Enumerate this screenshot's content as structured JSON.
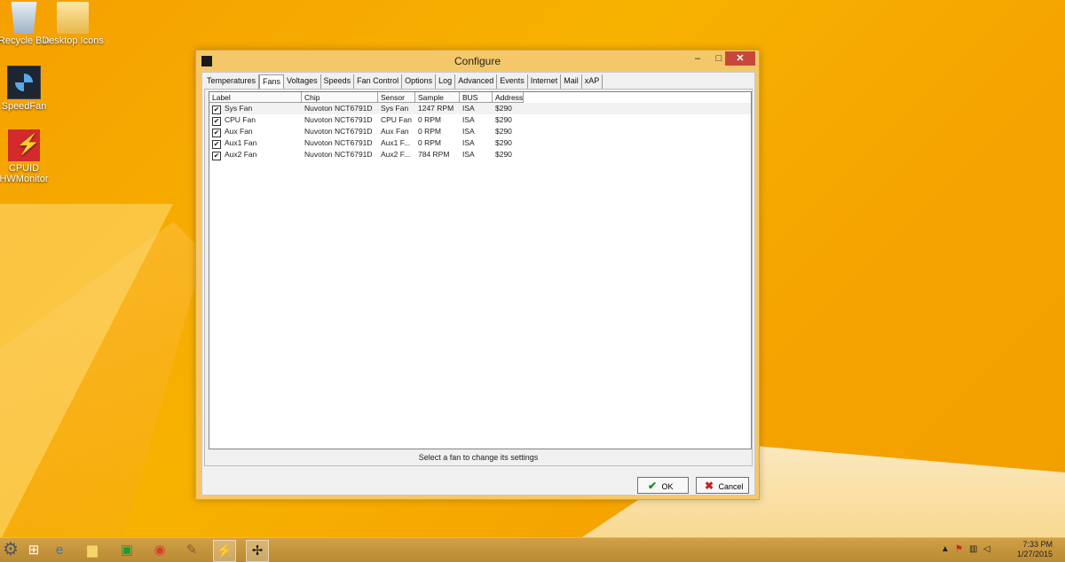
{
  "desktop": {
    "icons": [
      {
        "label": "Recycle Bin"
      },
      {
        "label": "Desktop Icons"
      },
      {
        "label": "SpeedFan"
      },
      {
        "label": "CPUID HWMonitor"
      }
    ]
  },
  "window": {
    "title": "Configure",
    "controls": {
      "minimize": "–",
      "maximize": "□",
      "close": "✕"
    },
    "tabs": [
      "Temperatures",
      "Fans",
      "Voltages",
      "Speeds",
      "Fan Control",
      "Options",
      "Log",
      "Advanced",
      "Events",
      "Internet",
      "Mail",
      "xAP"
    ],
    "active_tab": "Fans",
    "columns": [
      "Label",
      "Chip",
      "Sensor",
      "Sample",
      "BUS",
      "Address"
    ],
    "rows": [
      {
        "checked": "✔",
        "label": "Sys Fan",
        "chip": "Nuvoton NCT6791D",
        "sensor": "Sys Fan",
        "sample": "1247 RPM",
        "bus": "ISA",
        "address": "$290"
      },
      {
        "checked": "✔",
        "label": "CPU Fan",
        "chip": "Nuvoton NCT6791D",
        "sensor": "CPU Fan",
        "sample": "0 RPM",
        "bus": "ISA",
        "address": "$290"
      },
      {
        "checked": "✔",
        "label": "Aux Fan",
        "chip": "Nuvoton NCT6791D",
        "sensor": "Aux Fan",
        "sample": "0 RPM",
        "bus": "ISA",
        "address": "$290"
      },
      {
        "checked": "✔",
        "label": "Aux1 Fan",
        "chip": "Nuvoton NCT6791D",
        "sensor": "Aux1 F...",
        "sample": "0 RPM",
        "bus": "ISA",
        "address": "$290"
      },
      {
        "checked": "✔",
        "label": "Aux2 Fan",
        "chip": "Nuvoton NCT6791D",
        "sensor": "Aux2 F...",
        "sample": "784 RPM",
        "bus": "ISA",
        "address": "$290"
      }
    ],
    "status": "Select a fan to change its settings",
    "ok_label": "OK",
    "cancel_label": "Cancel"
  },
  "taskbar": {
    "items": [
      "settings-icon",
      "start-icon",
      "ie-icon",
      "explorer-icon",
      "store-icon",
      "chrome-icon",
      "paint-icon",
      "hwmonitor-icon",
      "speedfan-icon"
    ],
    "tray_arrow": "▲",
    "clock_time": "7:33 PM",
    "clock_date": "1/27/2015"
  }
}
